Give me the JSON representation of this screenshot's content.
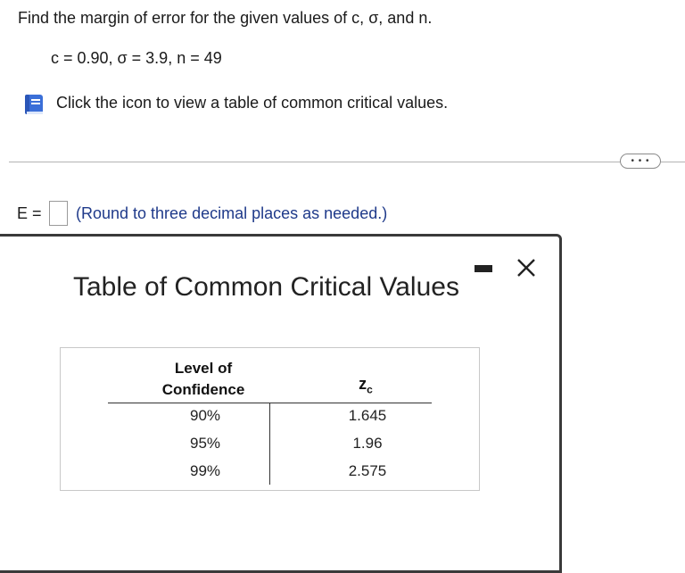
{
  "question": {
    "prompt": "Find the margin of error for the given values of c, σ, and n.",
    "givens": "c = 0.90, σ = 3.9, n = 49",
    "table_link_text": "Click the icon to view a table of common critical values.",
    "icon": "book-icon"
  },
  "divider": {
    "more_label": "• • •"
  },
  "answer": {
    "label": "E =",
    "value": "",
    "note": "(Round to three decimal places as needed.)"
  },
  "dialog": {
    "title": "Table of Common Critical Values",
    "header_level": "Level of Confidence",
    "header_z": "z",
    "header_z_sub": "c",
    "rows": [
      {
        "confidence": "90%",
        "z": "1.645"
      },
      {
        "confidence": "95%",
        "z": "1.96"
      },
      {
        "confidence": "99%",
        "z": "2.575"
      }
    ]
  },
  "colors": {
    "note_text": "#1f3a8a",
    "icon_blue": "#3b6fd8"
  }
}
